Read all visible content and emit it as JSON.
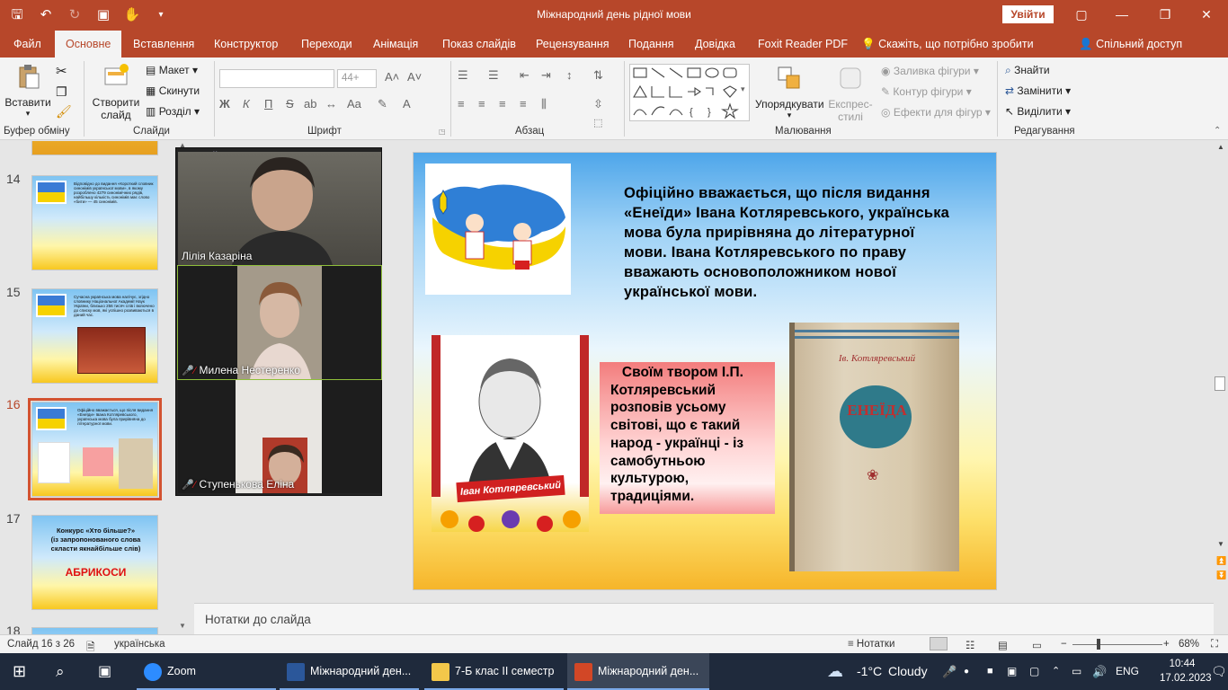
{
  "window": {
    "title": "Міжнародний день рідної мови",
    "signin_label": "Увійти"
  },
  "tabs": [
    {
      "label": "Файл"
    },
    {
      "label": "Основне"
    },
    {
      "label": "Вставлення"
    },
    {
      "label": "Конструктор"
    },
    {
      "label": "Переходи"
    },
    {
      "label": "Анімація"
    },
    {
      "label": "Показ слайдів"
    },
    {
      "label": "Рецензування"
    },
    {
      "label": "Подання"
    },
    {
      "label": "Довідка"
    },
    {
      "label": "Foxit Reader PDF"
    }
  ],
  "tellme": "Скажіть, що потрібно зробити",
  "share": "Спільний доступ",
  "ribbon": {
    "clipboard": {
      "paste": "Вставити",
      "group": "Буфер обміну"
    },
    "slides": {
      "new_slide_1": "Створити",
      "new_slide_2": "слайд",
      "layout": "Макет",
      "reset": "Скинути",
      "section": "Розділ",
      "group": "Слайди"
    },
    "font": {
      "group": "Шрифт",
      "size": "44+",
      "bold": "Ж",
      "italic": "К",
      "underline": "П",
      "strike": "S"
    },
    "paragraph": {
      "group": "Абзац"
    },
    "drawing": {
      "arrange_1": "Упорядкувати",
      "styles_1": "Експрес-",
      "styles_2": "стилі",
      "fill": "Заливка фігури",
      "outline": "Контур фігури",
      "effects": "Ефекти для фігур",
      "group": "Малювання"
    },
    "editing": {
      "find": "Знайти",
      "replace": "Замінити",
      "select": "Виділити",
      "group": "Редагування"
    }
  },
  "thumbnails": [
    {
      "num": "14",
      "text": "Відповідно до видання «Короткий словник синонімів української мови», в якому розроблено 4279 синонімічних рядів, найбільшу кількість синонімів має слово «бити» — 45 синонімів."
    },
    {
      "num": "15",
      "text": "Сучасна українська мова налічує, згідно словнику Національної Академії Наук України, близько 256 тисяч слів і включено до списку мов, які успішно розвиваються в даний час."
    },
    {
      "num": "16",
      "text": "Офіційно вважається, що після видання «Енеїди» Івана Котляревського, українська мова була прирівняна до літературної мови."
    },
    {
      "num": "17",
      "title_1": "Конкурс «Хто більше?»",
      "title_2": "(із запропонованого слова",
      "title_3": "скласти якнайбільше слів)",
      "word": "АБРИКОСИ"
    },
    {
      "num": "18"
    }
  ],
  "video_call": {
    "participants": [
      {
        "name": "Лілія Казаріна",
        "muted": false
      },
      {
        "name": "Милена Нестеренко",
        "muted": true
      },
      {
        "name": "Ступенькова Еліна",
        "muted": true
      }
    ]
  },
  "slide": {
    "main_text": "Офіційно вважається, що після видання «Енеїди» Івана Котляревського, українська мова була прирівняна до літературної мови. Івана Котляревського по праву вважають основоположником нової української мови.",
    "box_text": "   Своїм твором І.П. Котляревський розповів усьому світові, що є такий народ - українці - із самобутньою культурою, традиціями.",
    "portrait_caption": "Іван Котляревський",
    "book_author": "Ів. Котляревський",
    "book_title": "ЕНЕЇДА"
  },
  "notes_placeholder": "Нотатки до слайда",
  "status": {
    "slide_counter": "Слайд 16 з 26",
    "language": "українська",
    "notes_btn": "Нотатки",
    "zoom": "68%"
  },
  "taskbar": {
    "items": [
      {
        "label": "Zoom"
      },
      {
        "label": "Міжнародний ден..."
      },
      {
        "label": "7-Б клас ІІ семестр"
      },
      {
        "label": "Міжнародний ден..."
      }
    ],
    "weather_temp": "-1°C",
    "weather_desc": "Cloudy",
    "lang": "ENG",
    "time": "10:44",
    "date": "17.02.2023"
  },
  "colors": {
    "accent": "#b7472a",
    "selection": "#d35230",
    "taskbar": "#1f2a3c"
  }
}
